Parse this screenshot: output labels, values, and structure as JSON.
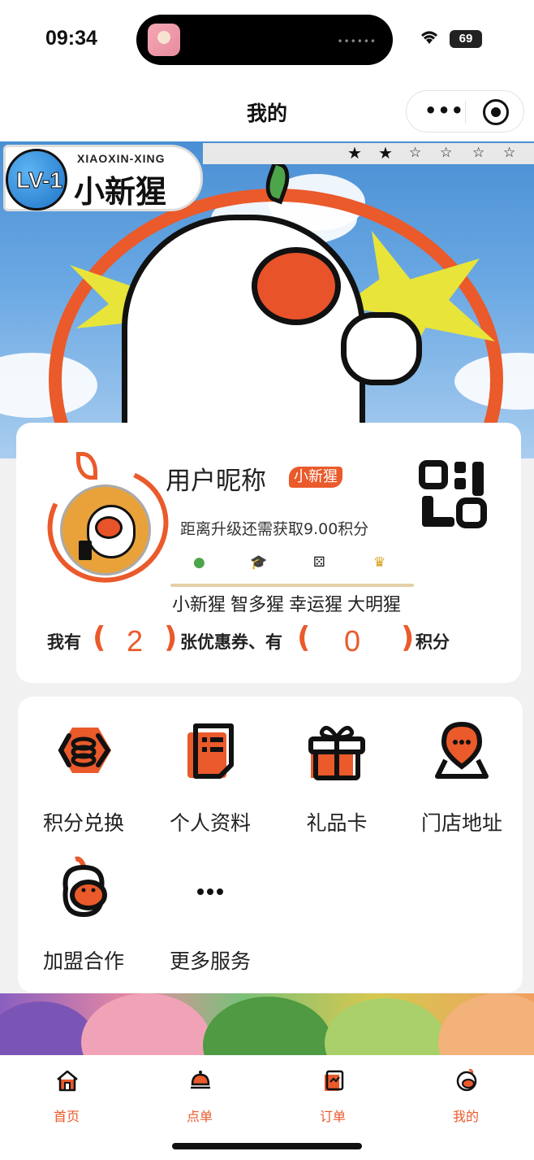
{
  "status_bar": {
    "time": "09:34",
    "battery": "69"
  },
  "nav": {
    "title": "我的",
    "more_icon": "ellipsis-icon",
    "close_icon": "target-icon"
  },
  "banner": {
    "level_code": "LV-1",
    "level_en": "XIAOXIN-XING",
    "level_cn": "小新猩",
    "stars_filled": 2,
    "stars_total": 6
  },
  "profile": {
    "nickname": "用户昵称",
    "level_tag": "小新猩",
    "upgrade_tip": "距离升级还需获取9.00积分",
    "level_names": [
      "小新猩",
      "智多猩",
      "幸运猩",
      "大明猩"
    ],
    "level_icons": [
      "leaf-icon",
      "graduation-cap-icon",
      "dice-icon",
      "crown-icon"
    ],
    "summary": {
      "prefix": "我有",
      "open_paren": "(",
      "close_paren": ")",
      "coupon_count": "2",
      "mid": "张优惠券、有",
      "points": "0",
      "suffix": "积分"
    }
  },
  "services": [
    {
      "label": "积分兑换",
      "icon": "points-exchange-icon"
    },
    {
      "label": "个人资料",
      "icon": "profile-document-icon"
    },
    {
      "label": "礼品卡",
      "icon": "gift-box-icon"
    },
    {
      "label": "门店地址",
      "icon": "location-pin-icon"
    },
    {
      "label": "加盟合作",
      "icon": "monkey-mascot-icon"
    },
    {
      "label": "更多服务",
      "icon": "more-dots-icon"
    }
  ],
  "tabs": [
    {
      "label": "首页",
      "icon": "home-icon"
    },
    {
      "label": "点单",
      "icon": "service-bell-icon"
    },
    {
      "label": "订单",
      "icon": "order-list-icon"
    },
    {
      "label": "我的",
      "icon": "monkey-profile-icon"
    }
  ],
  "colors": {
    "accent": "#ea5a2b",
    "sky": "#6aa8e3",
    "burst": "#e8e43a",
    "leaf": "#4da54a"
  }
}
